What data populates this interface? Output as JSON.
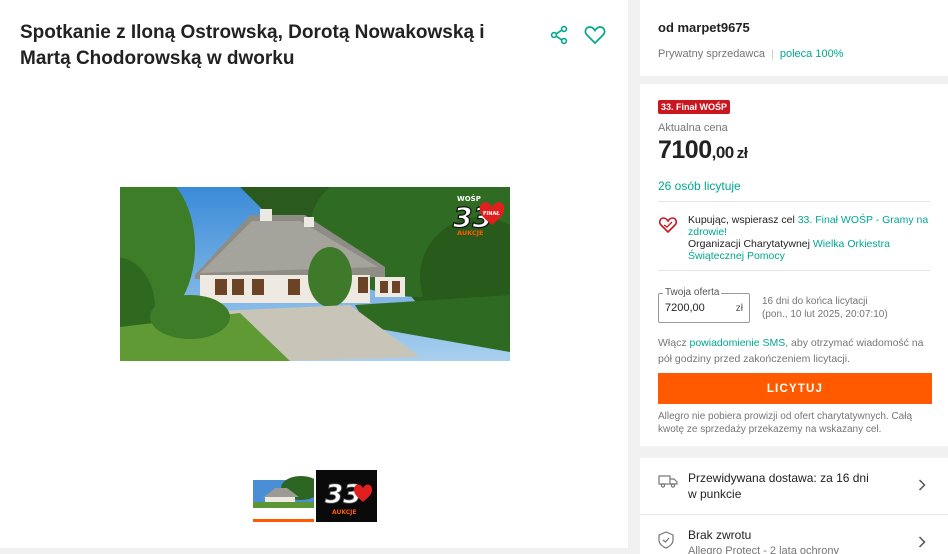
{
  "listing": {
    "title": "Spotkanie z Iloną Ostrowską, Dorotą Nowakowską i Martą Chodorowską w dworku"
  },
  "icons": {
    "share": "share-icon",
    "favorite": "heart-icon"
  },
  "seller": {
    "name": "od marpet9675",
    "type": "Prywatny sprzedawca",
    "rating": "poleca 100%"
  },
  "offer": {
    "badge": "33. Finał WOŚP",
    "price_label": "Aktualna cena",
    "price_main": "7100",
    "price_decimals": ",00",
    "currency": "zł",
    "bidders": "26 osób licytuje",
    "charity_prefix": "Kupując, wspierasz cel ",
    "charity_goal": "33. Finał WOŚP - Gramy na zdrowie!",
    "charity_org_prefix": "Organizacji Charytatywnej ",
    "charity_org": "Wielka Orkiestra Świątecznej Pomocy",
    "your_offer_label": "Twoja oferta",
    "your_offer_value": "7200,00",
    "your_offer_currency": "zł",
    "time_left": "16 dni do końca licytacji",
    "end_date": "(pon., 10 lut 2025, 20:07:10)",
    "sms_prefix": "Włącz ",
    "sms_link": "powiadomienie SMS",
    "sms_suffix": ", aby otrzymać wiadomość na pół godziny przed zakończeniem licytacji.",
    "bid_button": "LICYTUJ",
    "note": "Allegro nie pobiera prowizji od ofert charytatywnych. Całą kwotę ze sprzedaży przekazemy na wskazany cel."
  },
  "delivery": {
    "line1": "Przewidywana dostawa: za 16 dni",
    "line2": "w punkcie",
    "return_title": "Brak zwrotu",
    "return_sub": "Allegro Protect - 2 lata ochrony"
  },
  "wosp_logo": {
    "number": "33",
    "text": "AUKCJE",
    "heart_text": "FINAŁ"
  },
  "colors": {
    "accent": "#ff5a00",
    "link": "#00a790",
    "badge": "#c9161f"
  }
}
